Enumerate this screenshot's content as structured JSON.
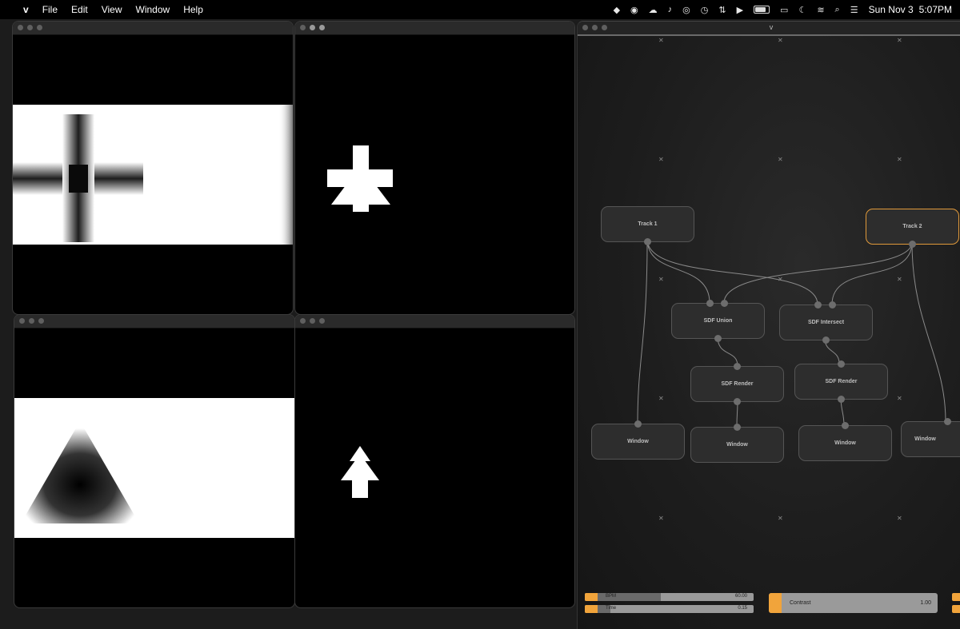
{
  "menubar": {
    "app": "v",
    "menus": [
      "File",
      "Edit",
      "View",
      "Window",
      "Help"
    ],
    "date": "Sun Nov 3",
    "time": "5:07PM"
  },
  "node_window": {
    "title": "v"
  },
  "nodes": {
    "track1": "Track 1",
    "track2": "Track 2",
    "union": "SDF Union",
    "intersect": "SDF Intersect",
    "render1": "SDF Render",
    "render2": "SDF Render",
    "window1": "Window",
    "window2": "Window",
    "window3": "Window",
    "window4": "Window"
  },
  "controls": {
    "bpm": {
      "label": "BPM",
      "value": "60.00",
      "level": 0.45
    },
    "time": {
      "label": "Time",
      "value": "0.15",
      "level": 0.15
    },
    "contrast": {
      "label": "Contrast",
      "value": "1.00"
    }
  },
  "colors": {
    "accent": "#f1a43b",
    "selected_border": "#e0993a"
  }
}
